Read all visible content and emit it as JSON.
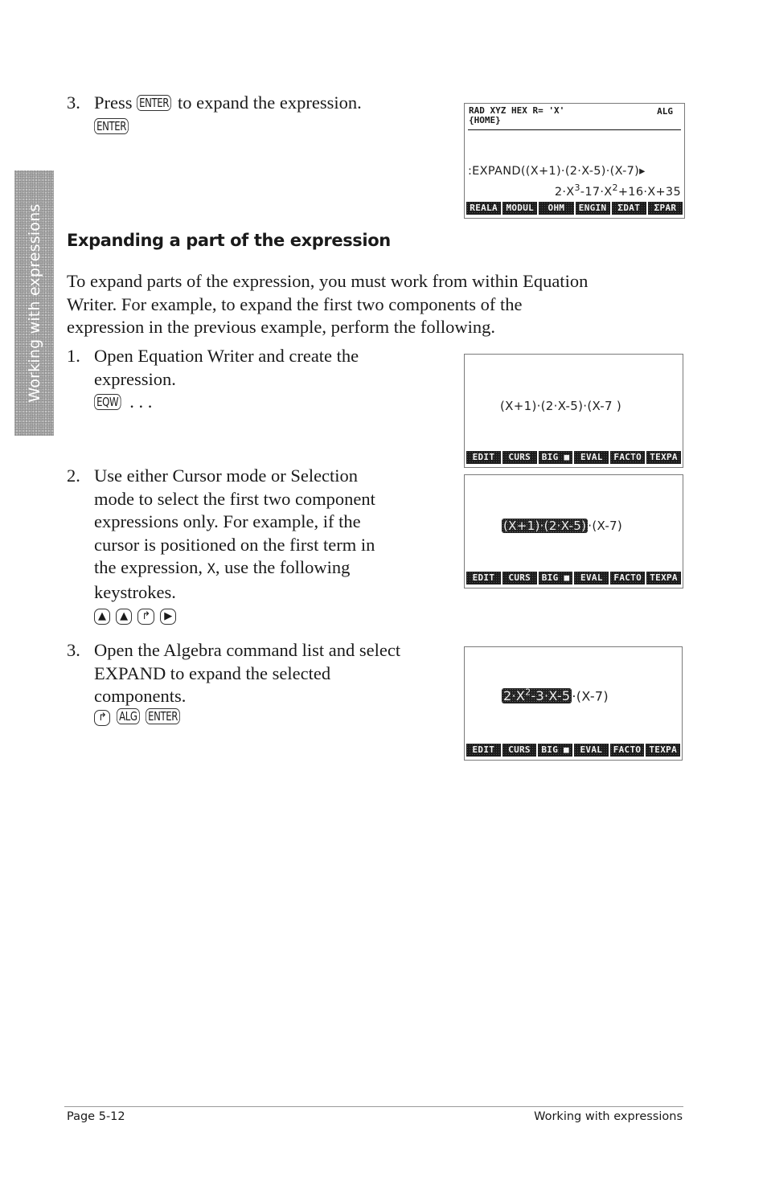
{
  "side_tab": {
    "label": "Working with expressions"
  },
  "step_intro": {
    "number": "3.",
    "text_before": "Press",
    "key": "ENTER",
    "text_after": "to expand the expression.",
    "keystrokes": [
      "ENTER"
    ]
  },
  "screen1": {
    "status_left": "RAD XYZ HEX R= 'X'",
    "status_right": "ALG",
    "path": "{HOME}",
    "command": ":EXPAND((X+1)·(2·X-5)·(X-7)▸",
    "result": {
      "c3": "2·X",
      "e3": "3",
      "c2": "-17·X",
      "e2": "2",
      "rest": "+16·X+35"
    },
    "softkeys": [
      "REALA",
      "MODUL",
      "OHM",
      "ENGIN",
      "ΣDAT",
      "ΣPAR"
    ]
  },
  "section": {
    "heading": "Expanding a part of the expression",
    "intro_lines": [
      "To expand parts of the expression, you must work from within Equation",
      "Writer. For example, to expand the first two components of the",
      "expression in the previous example, perform the following."
    ]
  },
  "steps": [
    {
      "number": "1.",
      "lines": [
        "Open Equation Writer and create the",
        "expression."
      ],
      "keystrokes": [
        "EQW"
      ],
      "trailing": ". . ."
    },
    {
      "number": "2.",
      "lines": [
        "Use either Cursor mode or Selection",
        "mode to select the first two component",
        "expressions only. For example, if the",
        "cursor is positioned on the first term in",
        "the expression,",
        "X",
        ", use the following",
        "keystrokes."
      ],
      "keystrokes": [
        "▲",
        "▲",
        "↱",
        "▶"
      ]
    },
    {
      "number": "3.",
      "lines": [
        "Open the Algebra command list and select",
        "EXPAND to expand the selected",
        "components."
      ],
      "keystrokes": [
        "↱",
        "ALG",
        "ENTER"
      ]
    }
  ],
  "screen2": {
    "expression": "(X+1)·(2·X-5)·(X-7 )",
    "softkeys": [
      "EDIT",
      "CURS",
      "BIG ■",
      "EVAL",
      "FACTO",
      "TEXPA"
    ]
  },
  "screen3": {
    "selected": "(X+1)·(2·X-5)",
    "rest": "·(X-7)",
    "softkeys": [
      "EDIT",
      "CURS",
      "BIG ■",
      "EVAL",
      "FACTO",
      "TEXPA"
    ]
  },
  "screen4": {
    "selected_a": "2·X",
    "selected_exp": "2",
    "selected_b": "-3·X-5",
    "rest": "·(X-7)",
    "softkeys": [
      "EDIT",
      "CURS",
      "BIG ■",
      "EVAL",
      "FACTO",
      "TEXPA"
    ]
  },
  "footer": {
    "page": "Page 5-12",
    "chapter": "Working with expressions"
  }
}
